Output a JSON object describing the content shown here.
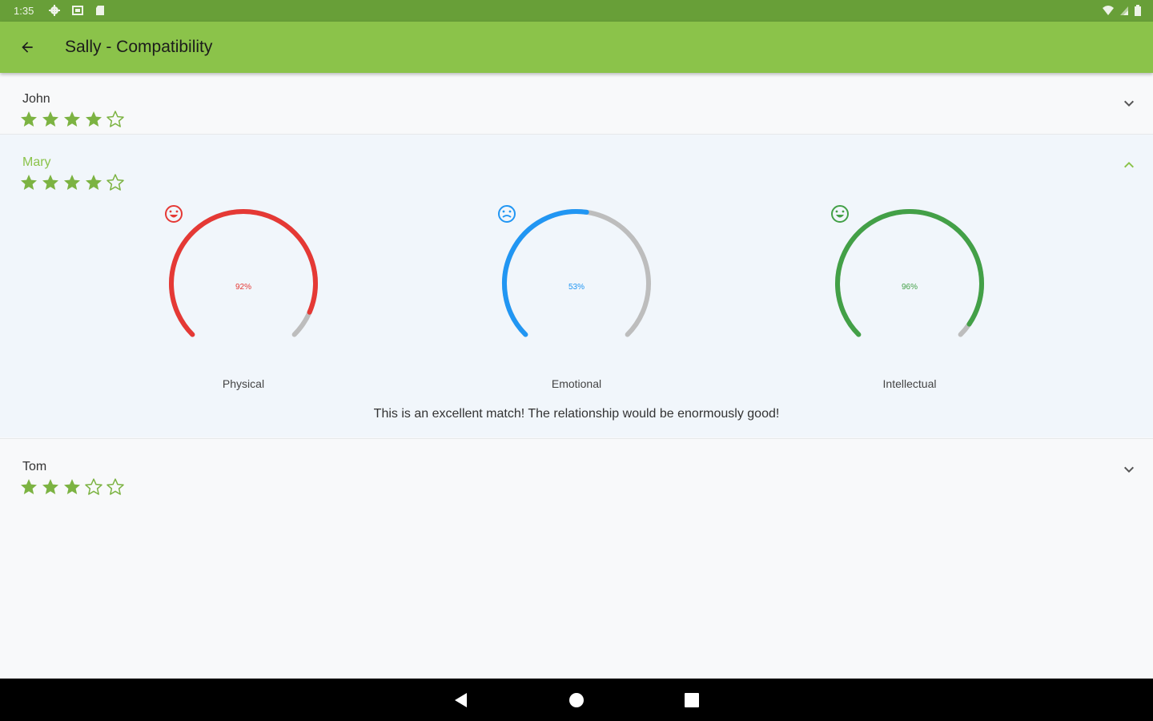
{
  "status_bar": {
    "time": "1:35",
    "icons_left": [
      "gear-icon",
      "square-icon",
      "sd-card-icon"
    ],
    "icons_right": [
      "wifi-icon",
      "signal-icon",
      "battery-icon"
    ]
  },
  "app_bar": {
    "title": "Sally - Compatibility",
    "back_icon": "arrow-back-icon",
    "color": "#8bc34a"
  },
  "matches": [
    {
      "name": "John",
      "rating": 4,
      "max_rating": 5,
      "expanded": false
    },
    {
      "name": "Mary",
      "rating": 4,
      "max_rating": 5,
      "expanded": true,
      "gauges": [
        {
          "label": "Physical",
          "value_text": "92%",
          "value": 0.92,
          "color": "#e53935",
          "icon": "smiley-icon"
        },
        {
          "label": "Emotional",
          "value_text": "53%",
          "value": 0.53,
          "color": "#2196f3",
          "icon": "neutral-face-icon"
        },
        {
          "label": "Intellectual",
          "value_text": "96%",
          "value": 0.96,
          "color": "#43a047",
          "icon": "smiley-icon"
        }
      ],
      "summary": "This is an excellent match! The relationship would be enormously good!"
    },
    {
      "name": "Tom",
      "rating": 3,
      "max_rating": 5,
      "expanded": false
    }
  ],
  "colors": {
    "accent": "#8bc34a",
    "status_bar": "#689f38",
    "star": "#7cb342",
    "track": "#bdbdbd"
  },
  "nav_bar": {
    "buttons": [
      "back-triangle-icon",
      "home-circle-icon",
      "recents-square-icon"
    ]
  }
}
